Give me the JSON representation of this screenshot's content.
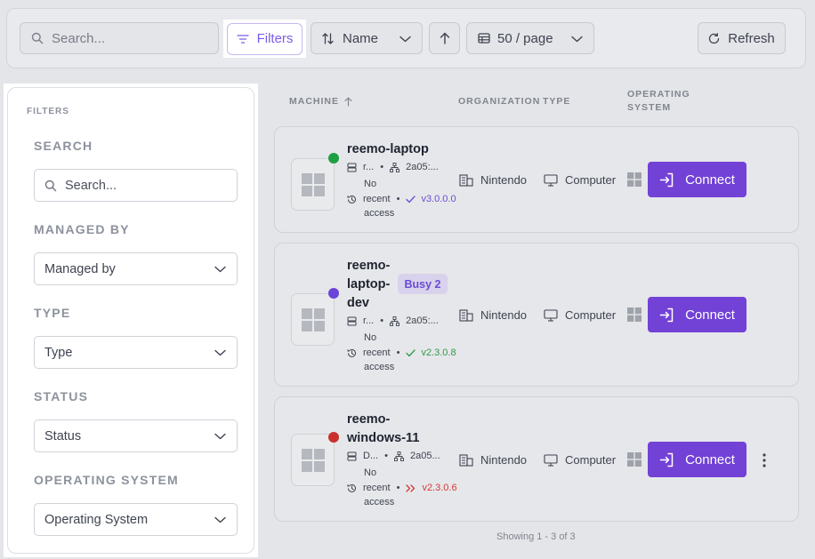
{
  "toolbar": {
    "search_placeholder": "Search...",
    "filters_label": "Filters",
    "sort_label": "Name",
    "page_size_label": "50 / page",
    "refresh_label": "Refresh"
  },
  "filters_panel": {
    "title": "FILTERS",
    "sections": [
      {
        "label": "SEARCH",
        "control": "Search..."
      },
      {
        "label": "MANAGED BY",
        "control": "Managed by"
      },
      {
        "label": "TYPE",
        "control": "Type"
      },
      {
        "label": "STATUS",
        "control": "Status"
      },
      {
        "label": "OPERATING SYSTEM",
        "control": "Operating System"
      }
    ]
  },
  "table": {
    "headers": {
      "machine": "MACHINE",
      "organization": "ORGANIZATION",
      "type": "TYPE",
      "os_line1": "OPERATING",
      "os_line2": "SYSTEM"
    },
    "connect_label": "Connect",
    "rows": [
      {
        "name_lines": [
          "reemo-laptop"
        ],
        "status_color": "#1e9f43",
        "badge": "",
        "server": "r...",
        "network": "2a05:...",
        "no_label": "No",
        "recent": "recent",
        "access": "access",
        "version": "v3.0.0.0",
        "version_color": "#6b4bd4",
        "version_icon": "check-icon",
        "organization": "Nintendo",
        "type": "Computer"
      },
      {
        "name_lines": [
          "reemo-",
          "laptop-",
          "dev"
        ],
        "status_color": "#6b45d6",
        "badge": "Busy 2",
        "server": "r...",
        "network": "2a05:...",
        "no_label": "No",
        "recent": "recent",
        "access": "access",
        "version": "v2.3.0.8",
        "version_color": "#2f9a4a",
        "version_icon": "check-icon",
        "organization": "Nintendo",
        "type": "Computer"
      },
      {
        "name_lines": [
          "reemo-",
          "windows-11"
        ],
        "status_color": "#c9302c",
        "badge": "",
        "server": "D...",
        "network": "2a05...",
        "no_label": "No",
        "recent": "recent",
        "access": "access",
        "version": "v2.3.0.6",
        "version_color": "#d2393a",
        "version_icon": "double-chevron-right-icon",
        "organization": "Nintendo",
        "type": "Computer"
      }
    ],
    "footer": "Showing 1 - 3 of 3"
  }
}
